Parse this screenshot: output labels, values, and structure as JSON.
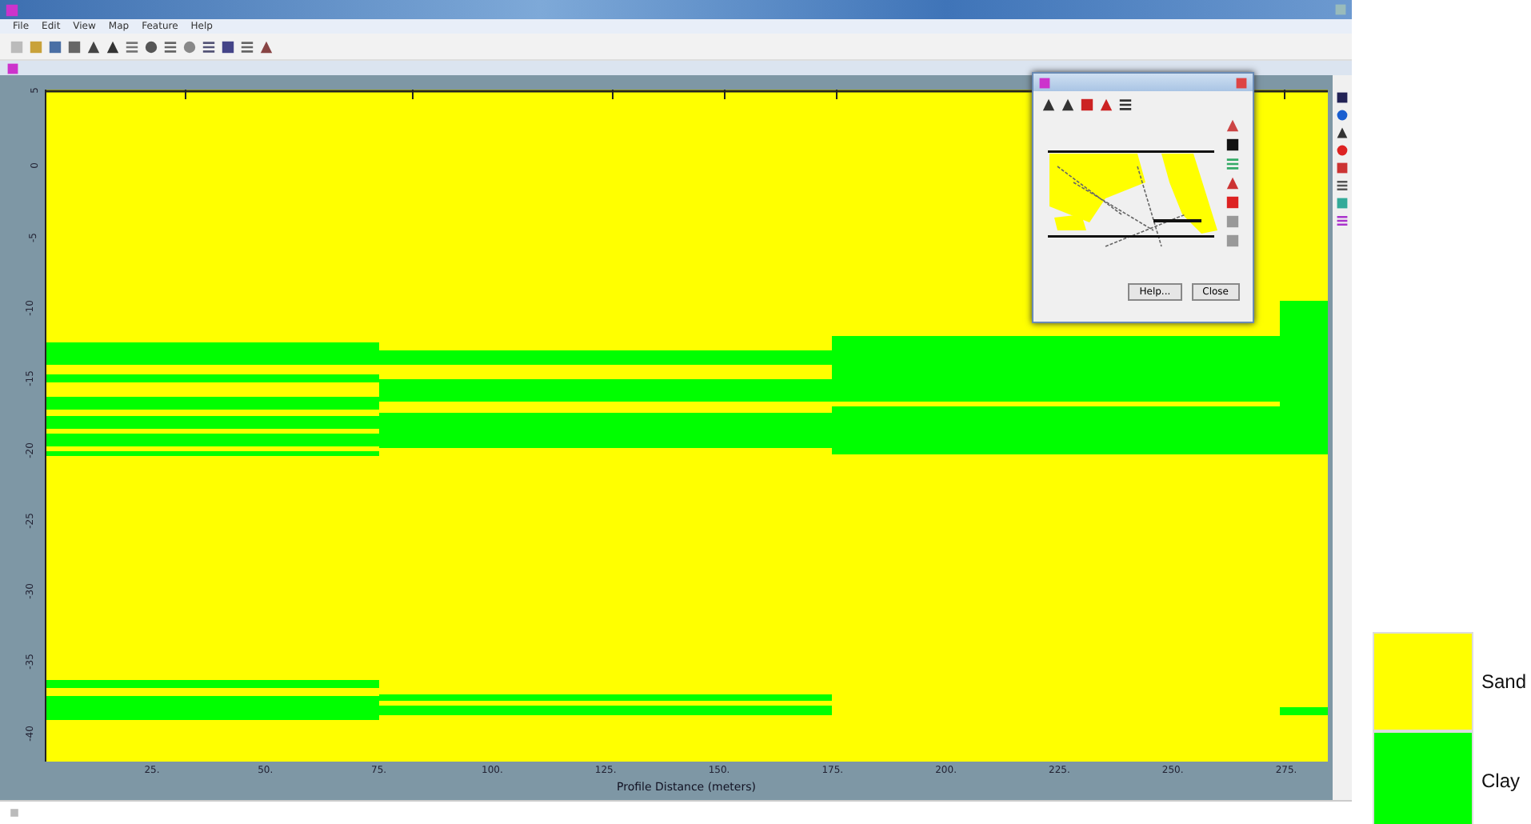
{
  "menu": [
    "File",
    "Edit",
    "View",
    "Map",
    "Feature",
    "Help"
  ],
  "plot": {
    "y_ticks": [
      "5",
      "0",
      "-5",
      "-10",
      "-15",
      "-20",
      "-25",
      "-30",
      "-35",
      "-40"
    ],
    "x_ticks": [
      "25.",
      "50.",
      "75.",
      "100.",
      "125.",
      "150.",
      "175.",
      "200.",
      "225.",
      "250.",
      "275."
    ],
    "x_label": "Profile Distance (meters)"
  },
  "dialog": {
    "buttons": [
      "Help...",
      "Close"
    ]
  },
  "legend": [
    {
      "name": "Sand",
      "color": "#ffff00"
    },
    {
      "name": "Clay",
      "color": "#00ff00"
    }
  ]
}
